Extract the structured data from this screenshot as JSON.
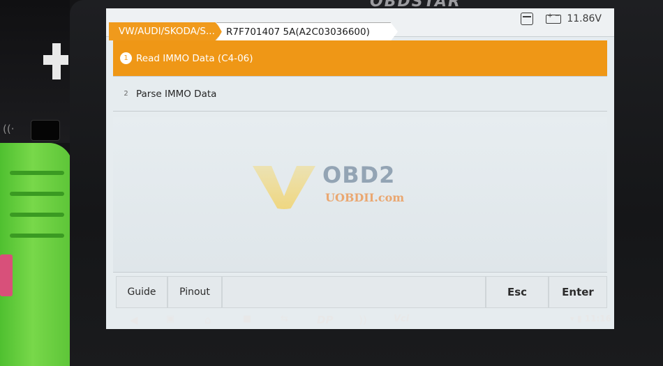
{
  "device": {
    "brand": "OBDSTAR"
  },
  "header": {
    "breadcrumbs": [
      "VW/AUDI/SKODA/S...",
      "R7F701407 5A(A2C03036600)"
    ],
    "battery_voltage": "11.86V"
  },
  "menu": {
    "items": [
      {
        "num": "1",
        "label": "Read IMMO Data (C4-06)",
        "selected": true
      },
      {
        "num": "2",
        "label": "Parse IMMO Data",
        "selected": false
      }
    ]
  },
  "watermark": {
    "logo_text": "OBD2",
    "site": "UOBDII.com"
  },
  "toolbar": {
    "guide": "Guide",
    "pinout": "Pinout",
    "esc": "Esc",
    "enter": "Enter"
  },
  "navbar": {
    "dp_label": "DP",
    "vci_label": "Vci",
    "time": "11:16"
  },
  "colors": {
    "accent": "#ef9716",
    "grip": "#5cc437"
  },
  "icons": [
    "back-icon",
    "screenshot-icon",
    "home-icon",
    "recent-apps-icon",
    "teamviewer-icon",
    "dp-icon",
    "wifi-icon",
    "vci-icon",
    "calendar-icon",
    "battery-icon"
  ]
}
